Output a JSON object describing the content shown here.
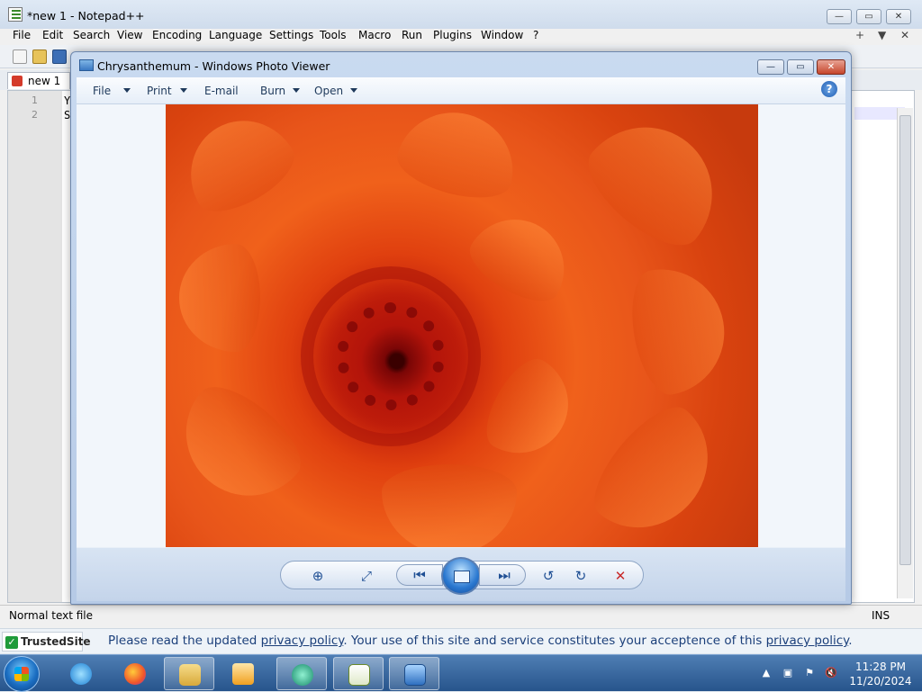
{
  "notepad": {
    "title": "*new 1 - Notepad++",
    "menu": [
      "File",
      "Edit",
      "Search",
      "View",
      "Encoding",
      "Language",
      "Settings",
      "Tools",
      "Macro",
      "Run",
      "Plugins",
      "Window",
      "?"
    ],
    "menu_right": [
      "+",
      "▼",
      "✕"
    ],
    "tab_label": "new 1",
    "lines": [
      {
        "num": "1",
        "text": "Y"
      },
      {
        "num": "2",
        "text": "S"
      }
    ],
    "status_left": "Normal text file",
    "status_right": "INS"
  },
  "photo_viewer": {
    "title": "Chrysanthemum - Windows Photo Viewer",
    "commands": [
      "File",
      "Print",
      "E-mail",
      "Burn",
      "Open"
    ],
    "help_glyph": "?",
    "caption_min": "—",
    "caption_max": "▭",
    "caption_close": "✕",
    "nav": {
      "zoom": "⊕",
      "fit": "⤢",
      "prev": "⏮",
      "next": "⏭",
      "rotate_ccw": "↺",
      "rotate_cw": "↻",
      "delete": "✕"
    },
    "image_subject": "chrysanthemum flower photo",
    "colors": {
      "petal_light": "#f0611b",
      "petal_dark": "#c4210b",
      "center": "#3a0000"
    }
  },
  "banner": {
    "trusted": "TrustedSite",
    "msg_1": "Please read the updated ",
    "link_1": "privacy policy",
    "msg_2": ". Your use of this site and service constitutes your acceptence of this ",
    "link_2": "privacy policy",
    "msg_3": "."
  },
  "taskbar": {
    "clock_time": "11:28 PM",
    "clock_date": "11/20/2024"
  }
}
